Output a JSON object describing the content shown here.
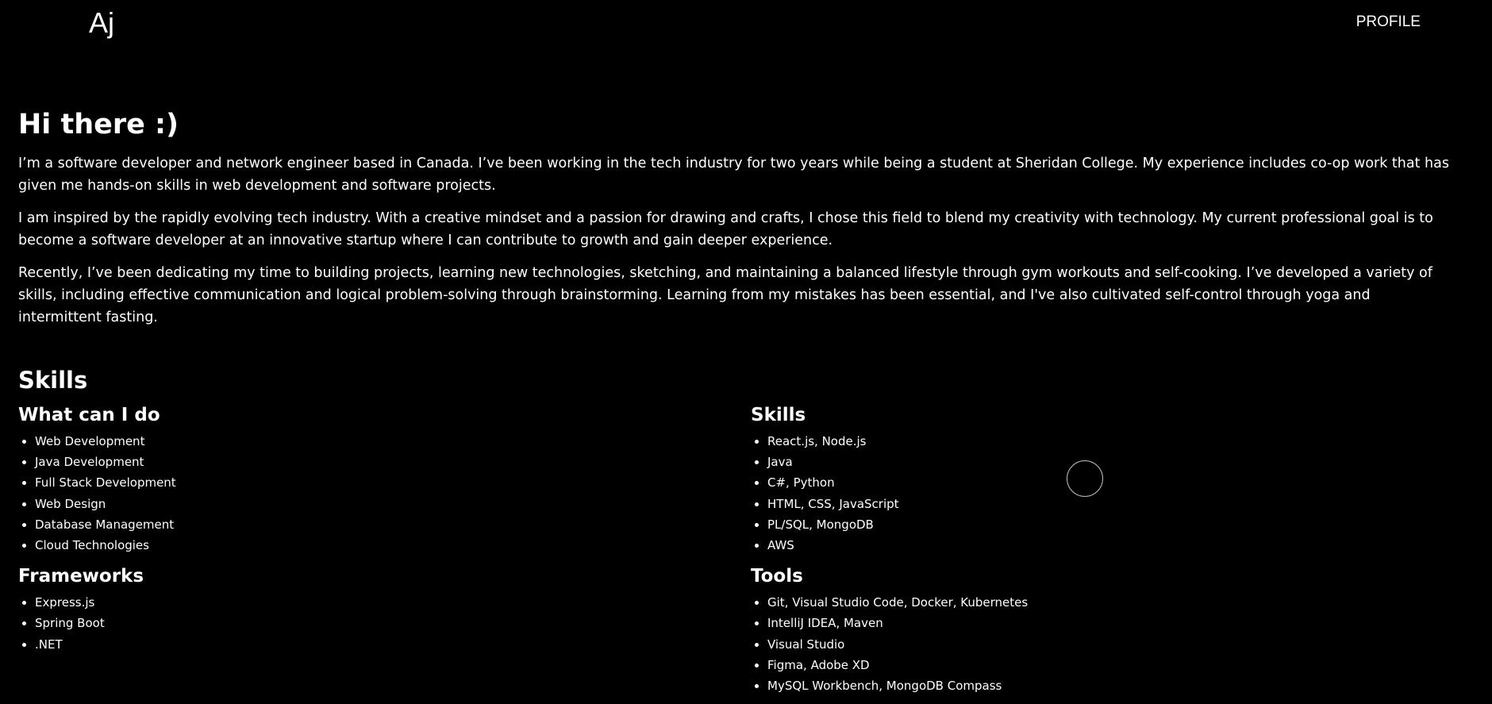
{
  "header": {
    "logo": "Aj",
    "nav_profile": "PROFILE"
  },
  "intro": {
    "greeting": "Hi there :)",
    "paragraphs": [
      "I’m a software developer and network engineer based in Canada. I’ve been working in the tech industry for two years while being a student at Sheridan College. My experience includes co-op work that has given me hands-on skills in web development and software projects.",
      "I am inspired by the rapidly evolving tech industry. With a creative mindset and a passion for drawing and crafts, I chose this field to blend my creativity with technology. My current professional goal is to become a software developer at an innovative startup where I can contribute to growth and gain deeper experience.",
      "Recently, I’ve been dedicating my time to building projects, learning new technologies, sketching, and maintaining a balanced lifestyle through gym workouts and self-cooking. I’ve developed a variety of skills, including effective communication and logical problem-solving through brainstorming. Learning from my mistakes has been essential, and I've also cultivated self-control through yoga and intermittent fasting."
    ]
  },
  "skills": {
    "title": "Skills",
    "what_can_i_do": {
      "title": "What can I do",
      "items": [
        "Web Development",
        "Java Development",
        "Full Stack Development",
        "Web Design",
        "Database Management",
        "Cloud Technologies"
      ]
    },
    "frameworks": {
      "title": "Frameworks",
      "items": [
        "Express.js",
        "Spring Boot",
        ".NET"
      ]
    },
    "skills_list": {
      "title": "Skills",
      "items": [
        "React.js, Node.js",
        "Java",
        "C#, Python",
        "HTML, CSS, JavaScript",
        "PL/SQL, MongoDB",
        "AWS"
      ]
    },
    "tools": {
      "title": "Tools",
      "items": [
        "Git, Visual Studio Code, Docker, Kubernetes",
        "IntelliJ IDEA, Maven",
        "Visual Studio",
        "Figma, Adobe XD",
        "MySQL Workbench, MongoDB Compass"
      ]
    }
  }
}
